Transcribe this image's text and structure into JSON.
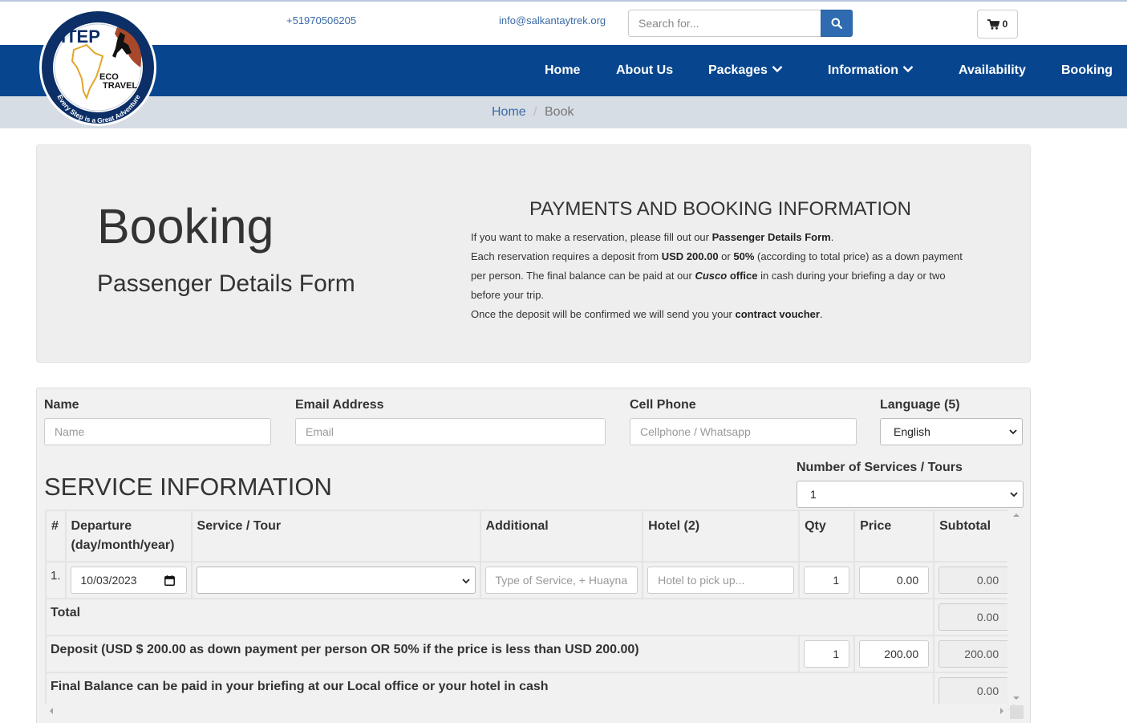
{
  "topbar": {
    "phone": "+51970506205",
    "email": "info@salkantaytrek.org",
    "search_placeholder": "Search for...",
    "cart_count": "0"
  },
  "logo": {
    "brand": "ITEP",
    "line1": "ECO",
    "line2": "TRAVEL",
    "tagline": "Every Step is a Great Adventure"
  },
  "nav": {
    "items": [
      {
        "label": "Home"
      },
      {
        "label": "About Us"
      },
      {
        "label": "Packages"
      },
      {
        "label": "Information"
      },
      {
        "label": "Availability"
      },
      {
        "label": "Booking"
      }
    ]
  },
  "breadcrumb": {
    "home": "Home",
    "separator": "/",
    "current": "Book"
  },
  "hero": {
    "title": "Booking",
    "subtitle": "Passenger Details Form",
    "payments_title": "PAYMENTS AND BOOKING INFORMATION",
    "p1_a": "If you want to make a reservation, please fill out our ",
    "p1_b": "Passenger Details Form",
    "p1_c": ".",
    "p2_a": "Each reservation requires a deposit from ",
    "p2_b": "USD 200.00",
    "p2_c": " or ",
    "p2_d": "50%",
    "p2_e": " (according to total price) as a down payment per person. The final balance can be paid at our ",
    "p2_f": "Cusco",
    "p2_g": "office",
    "p2_h": " in cash during your briefing a day or two before your trip.",
    "p3_a": "Once the deposit will be confirmed we will send you your ",
    "p3_b": "contract voucher",
    "p3_c": "."
  },
  "form": {
    "name_label": "Name",
    "name_placeholder": "Name",
    "email_label": "Email Address",
    "email_placeholder": "Email",
    "phone_label": "Cell Phone",
    "phone_placeholder": "Cellphone / Whatsapp",
    "language_label": "Language (5)",
    "language_value": "English",
    "num_services_label": "Number of Services / Tours",
    "num_services_value": "1"
  },
  "service": {
    "title": "SERVICE INFORMATION",
    "headers": {
      "num": "#",
      "departure_1": "Departure",
      "departure_2": "(day/month/year)",
      "service": "Service / Tour",
      "additional": "Additional",
      "hotel": "Hotel (2)",
      "qty": "Qty",
      "price": "Price",
      "subtotal": "Subtotal"
    },
    "row": {
      "num": "1.",
      "date": "10/03/2023",
      "service_value": "",
      "additional_placeholder": "Type of Service, + Huayna",
      "hotel_placeholder": "Hotel to pick up...",
      "qty": "1",
      "price": "0.00",
      "subtotal": "0.00"
    },
    "total_label": "Total",
    "total_value": "0.00",
    "deposit_label": "Deposit (USD $ 200.00 as down payment per person OR 50% if the price is less than USD 200.00)",
    "deposit_qty": "1",
    "deposit_price": "200.00",
    "deposit_subtotal": "200.00",
    "balance_label": "Final Balance can be paid in your briefing at our Local office or your hotel in cash",
    "balance_value": "0.00"
  },
  "colors": {
    "navbar": "#07468f",
    "search_button": "#2e6bb0",
    "breadcrumb_bg": "#d7dde4",
    "hero_bg": "#eeeeee",
    "link": "#3a6aa8"
  }
}
